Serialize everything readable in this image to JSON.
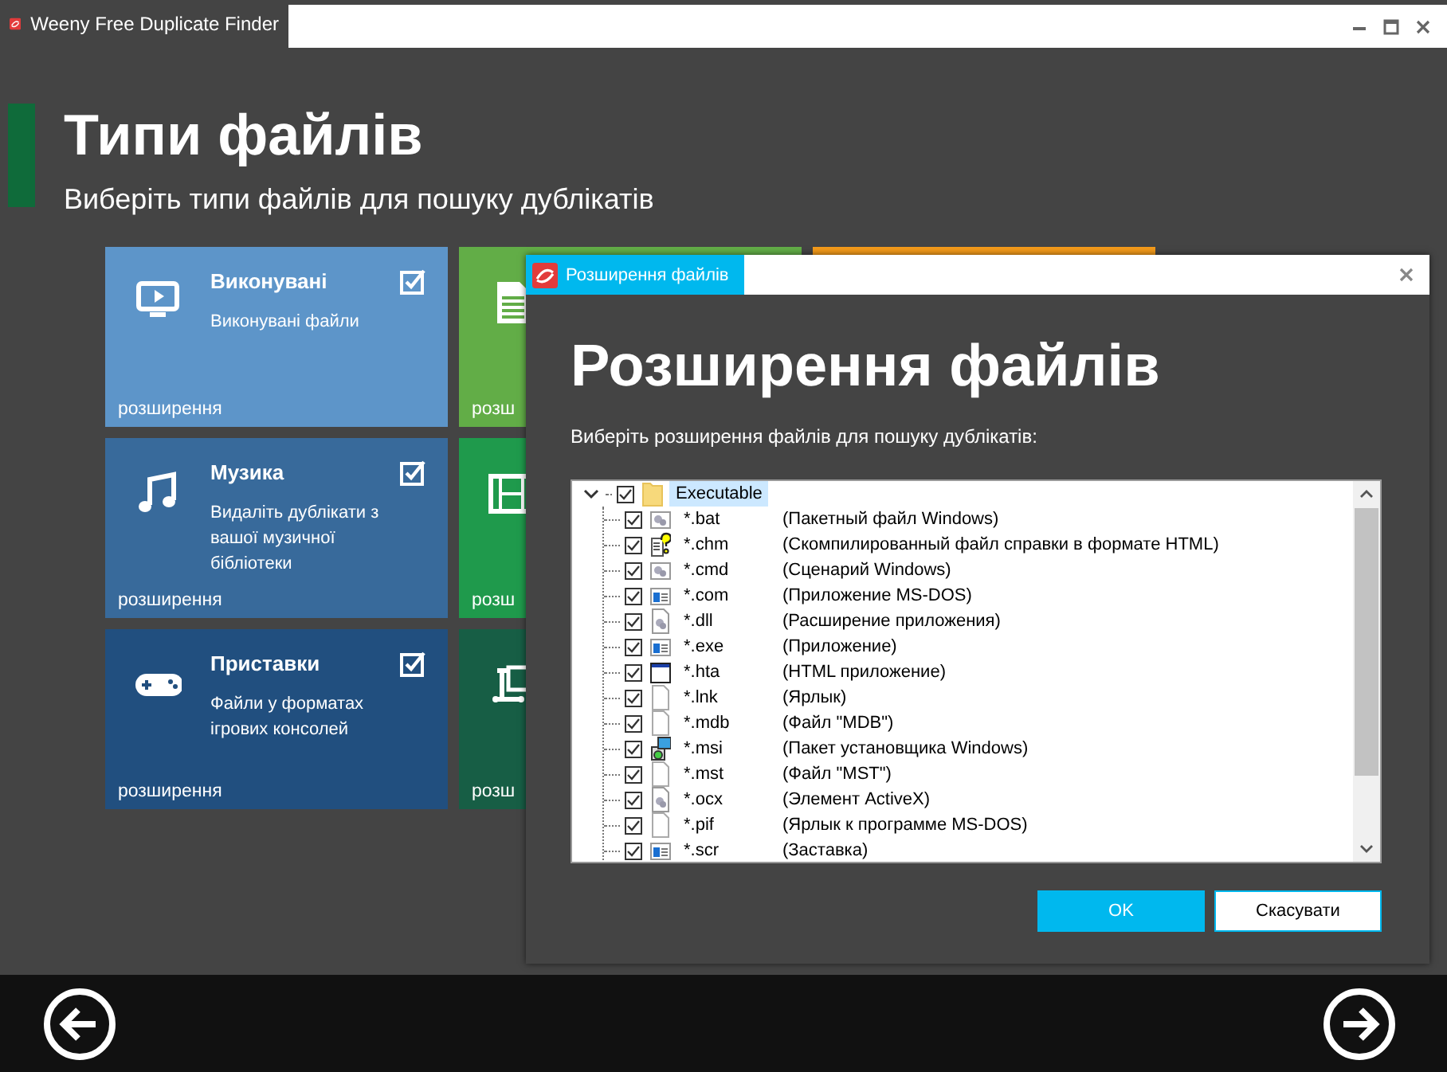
{
  "window": {
    "title": "Weeny Free Duplicate Finder"
  },
  "header": {
    "title": "Типи файлів",
    "subtitle": "Виберіть типи файлів для пошуку дублікатів"
  },
  "tiles": [
    {
      "kind": "monitor",
      "color": "#5d95c9",
      "title": "Виконувані",
      "description": "Виконувані файли",
      "checked": true,
      "footer": "розширення"
    },
    {
      "kind": "music",
      "color": "#386a9b",
      "title": "Музика",
      "description": "Видаліть дублікати з вашої музичної бібліотеки",
      "checked": true,
      "footer": "розширення"
    },
    {
      "kind": "gamepad",
      "color": "#214f7f",
      "title": "Приставки",
      "description": "Файли у форматах ігрових консолей",
      "checked": true,
      "footer": "розширення"
    },
    {
      "kind": "document",
      "color": "#62ad47",
      "footer": "розш"
    },
    {
      "kind": "film",
      "color": "#1f9a4c",
      "footer": "розш"
    },
    {
      "kind": "device",
      "color": "#175e45",
      "footer": "розш"
    },
    {
      "kind": "strip",
      "color": "#f39a1a"
    }
  ],
  "dialog": {
    "title": "Розширення файлів",
    "heading": "Розширення файлів",
    "subtitle": "Виберіть розширення файлів для пошуку дублікатів:",
    "tree": {
      "label": "Executable",
      "checked": true,
      "expanded": true,
      "selected": true,
      "children": [
        {
          "ext": "*.bat",
          "description": "(Пакетный файл Windows)",
          "kind": "gears",
          "checked": true,
          "selected": false
        },
        {
          "ext": "*.chm",
          "description": "(Скомпилированный файл справки в формате HTML)",
          "kind": "help",
          "checked": true,
          "selected": false
        },
        {
          "ext": "*.cmd",
          "description": "(Сценарий Windows)",
          "kind": "gears",
          "checked": true,
          "selected": false
        },
        {
          "ext": "*.com",
          "description": "(Приложение MS-DOS)",
          "kind": "app",
          "checked": true,
          "selected": false
        },
        {
          "ext": "*.dll",
          "description": "(Расширение приложения)",
          "kind": "gearsdoc",
          "checked": true,
          "selected": false
        },
        {
          "ext": "*.exe",
          "description": "(Приложение)",
          "kind": "app",
          "checked": true,
          "selected": false
        },
        {
          "ext": "*.hta",
          "description": "(HTML приложение)",
          "kind": "window",
          "checked": true,
          "selected": false
        },
        {
          "ext": "*.lnk",
          "description": "(Ярлык)",
          "kind": "blank",
          "checked": true,
          "selected": false
        },
        {
          "ext": "*.mdb",
          "description": "(Файл \"MDB\")",
          "kind": "blank",
          "checked": true,
          "selected": false
        },
        {
          "ext": "*.msi",
          "description": "(Пакет установщика Windows)",
          "kind": "installer",
          "checked": true,
          "selected": false
        },
        {
          "ext": "*.mst",
          "description": "(Файл \"MST\")",
          "kind": "blank",
          "checked": true,
          "selected": false
        },
        {
          "ext": "*.ocx",
          "description": "(Элемент ActiveX)",
          "kind": "gearsdoc",
          "checked": true,
          "selected": false
        },
        {
          "ext": "*.pif",
          "description": "(Ярлык к программе MS-DOS)",
          "kind": "blank",
          "checked": true,
          "selected": false
        },
        {
          "ext": "*.scr",
          "description": "(Заставка)",
          "kind": "app",
          "checked": true,
          "selected": false
        }
      ]
    },
    "buttons": [
      {
        "label": "OK",
        "kind": "primary"
      },
      {
        "label": "Скасувати",
        "kind": "secondary"
      }
    ]
  }
}
